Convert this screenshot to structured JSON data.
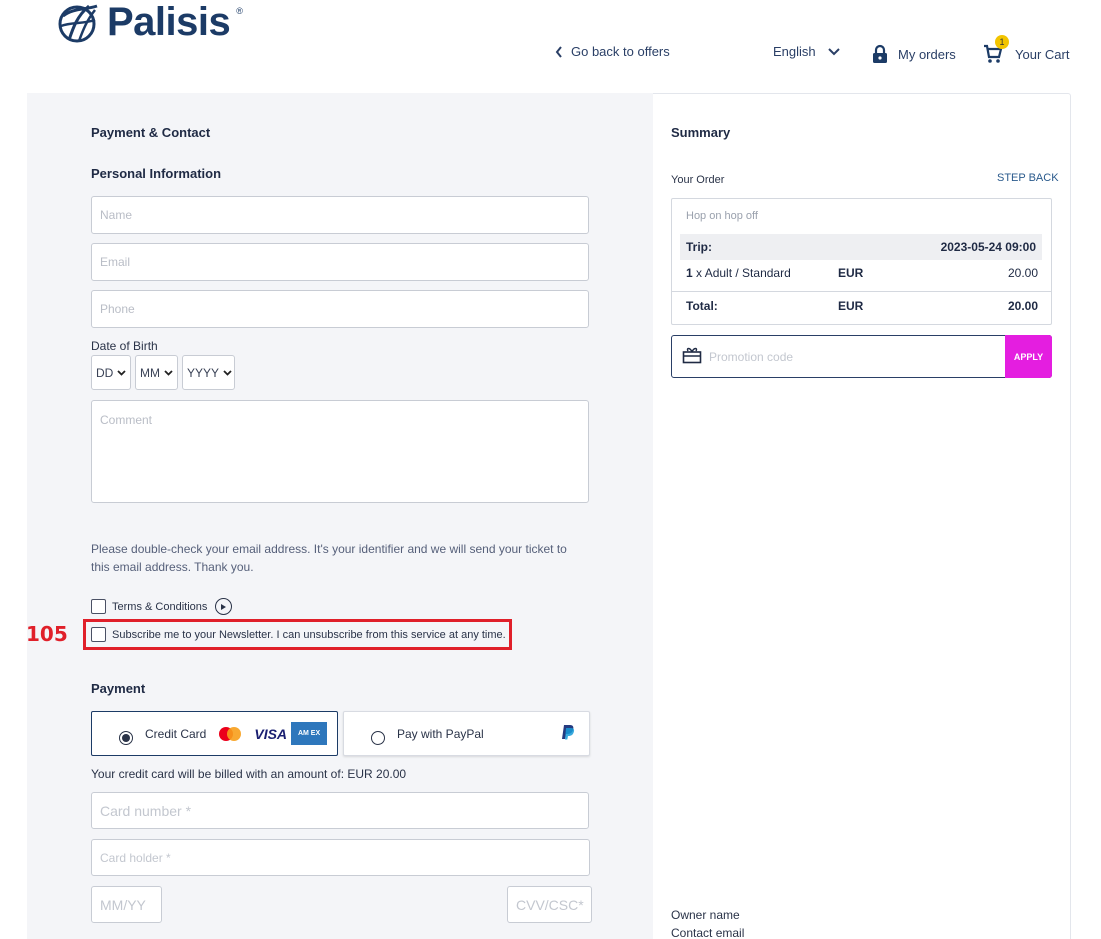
{
  "header": {
    "logo_text": "Palisis",
    "logo_reg": "®",
    "back_link": "Go back to offers",
    "language": "English",
    "my_orders": "My orders",
    "cart_label": "Your Cart",
    "cart_count": "1"
  },
  "form": {
    "title": "Payment & Contact",
    "personal_title": "Personal Information",
    "name_placeholder": "Name",
    "email_placeholder": "Email",
    "phone_placeholder": "Phone",
    "dob_label": "Date of Birth",
    "dob_day": "DD",
    "dob_month": "MM",
    "dob_year": "YYYY",
    "comment_placeholder": "Comment",
    "email_notice": "Please double-check your email address. It's your identifier and we will send your ticket to this email address. Thank you.",
    "terms_label": "Terms & Conditions",
    "newsletter_label": "Subscribe me to your Newsletter. I can unsubscribe from this service at any time.",
    "annotation_number": "105"
  },
  "payment": {
    "title": "Payment",
    "credit_card_label": "Credit Card",
    "visa_text": "VISA",
    "amex_text": "AM EX",
    "paypal_label": "Pay with PayPal",
    "billed_notice": "Your credit card will be billed with an amount of: EUR 20.00",
    "card_number_placeholder": "Card number *",
    "card_holder_placeholder": "Card holder *",
    "expiry_placeholder": "MM/YY",
    "cvv_placeholder": "CVV/CSC*"
  },
  "summary": {
    "title": "Summary",
    "your_order": "Your Order",
    "step_back": "STEP BACK",
    "order_name": "Hop on hop off",
    "trip_label": "Trip:",
    "trip_datetime": "2023-05-24 09:00",
    "item_qty": "1",
    "item_desc": "x Adult / Standard",
    "item_currency": "EUR",
    "item_price": "20.00",
    "total_label": "Total:",
    "total_currency": "EUR",
    "total_price": "20.00",
    "promo_placeholder": "Promotion code",
    "apply_label": "APPLY",
    "owner_name": "Owner name",
    "contact_email": "Contact email"
  },
  "colors": {
    "brand": "#1c3b66",
    "apply": "#e41ee0",
    "badge": "#f2c400",
    "annotation": "#e0202a"
  }
}
